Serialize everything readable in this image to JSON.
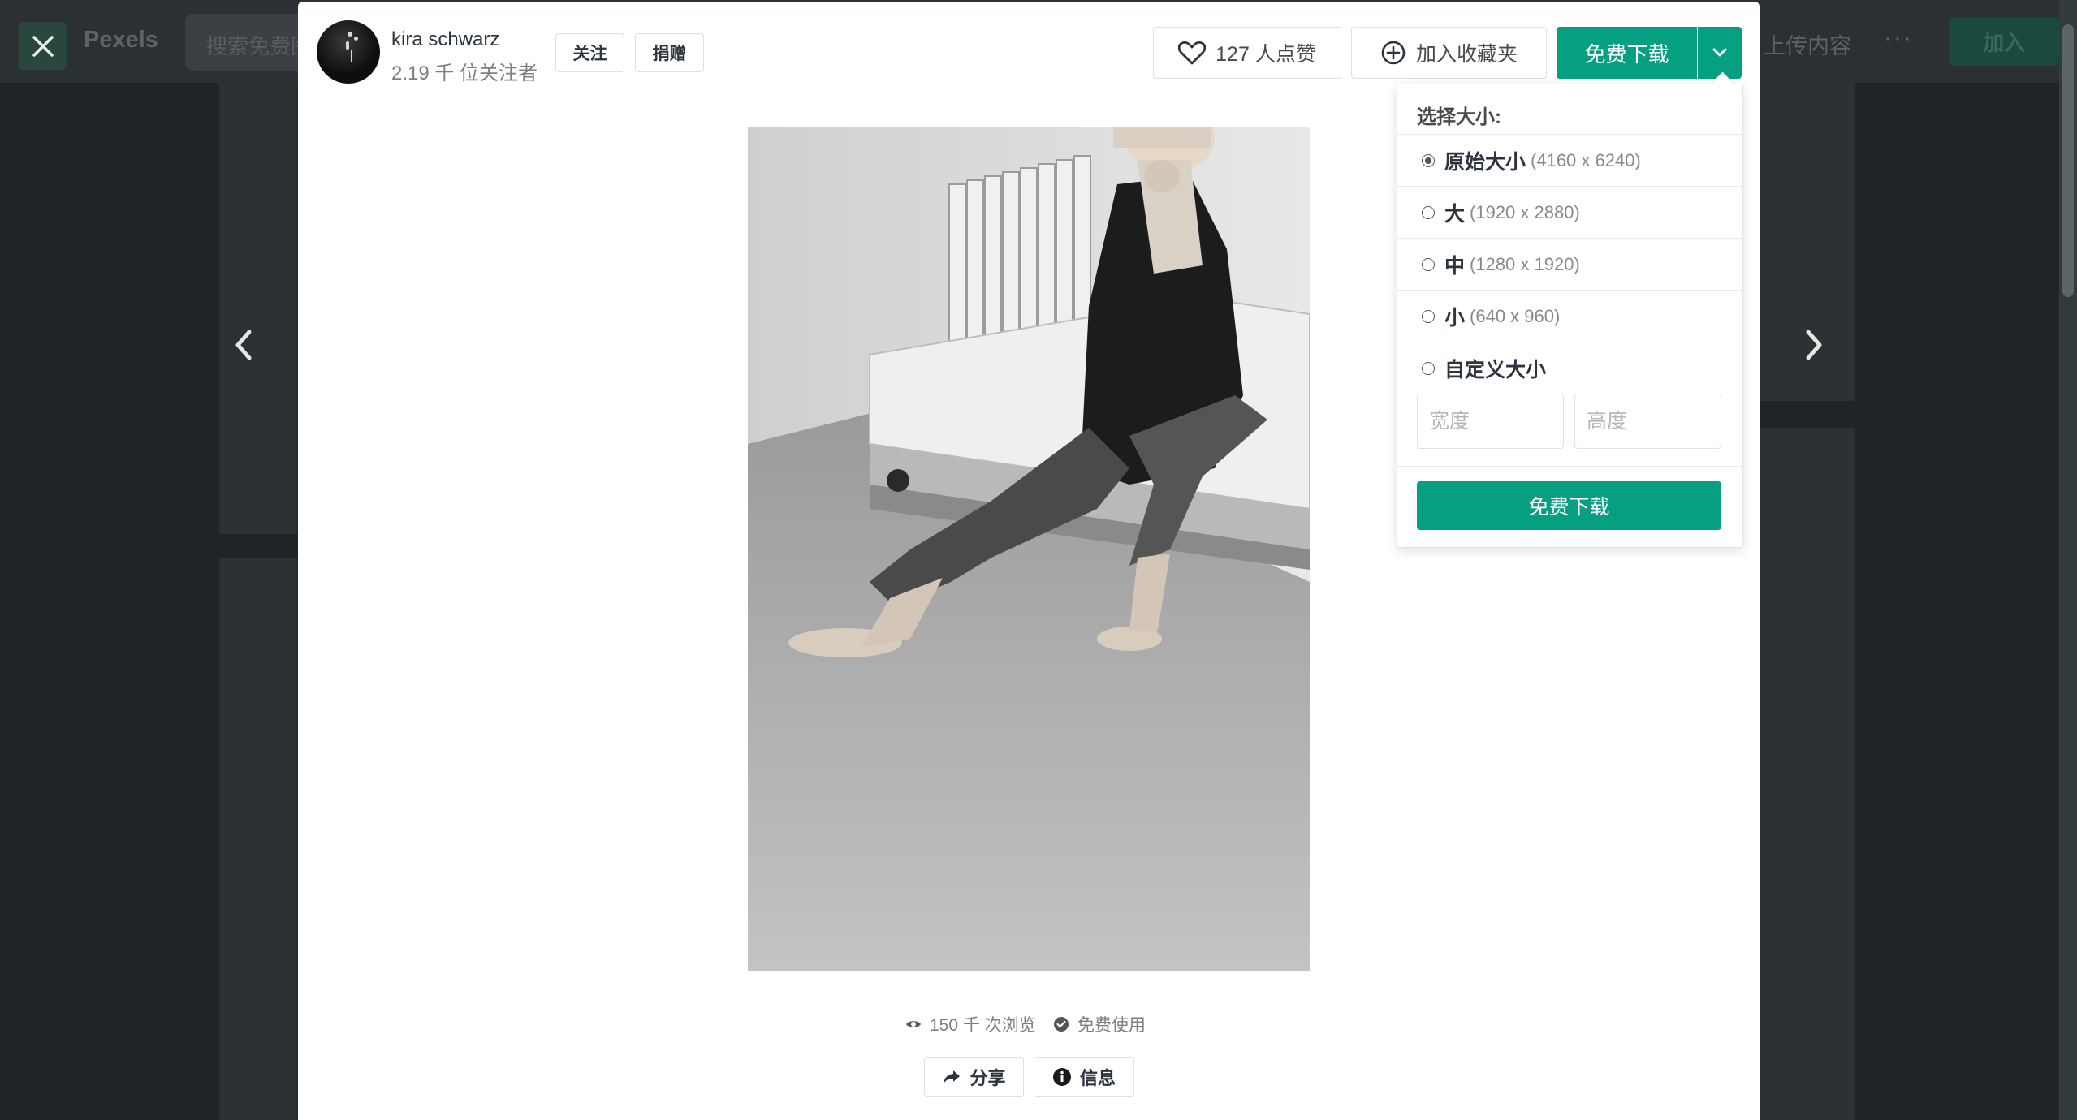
{
  "background": {
    "logo": "Pexels",
    "search_placeholder": "搜索免费图",
    "upload_label": "上传内容",
    "more_label": "···",
    "join_label": "加入"
  },
  "author": {
    "name": "kira schwarz",
    "followers": "2.19 千 位关注者",
    "follow_label": "关注",
    "donate_label": "捐赠"
  },
  "actions": {
    "like_label": "127 人点赞",
    "collect_label": "加入收藏夹",
    "download_label": "免费下载"
  },
  "dropdown": {
    "title": "选择大小:",
    "options": [
      {
        "name": "原始大小",
        "dims": "(4160 x 6240)",
        "selected": true
      },
      {
        "name": "大",
        "dims": "(1920 x 2880)",
        "selected": false
      },
      {
        "name": "中",
        "dims": "(1280 x 1920)",
        "selected": false
      },
      {
        "name": "小",
        "dims": "(640 x 960)",
        "selected": false
      },
      {
        "name": "自定义大小",
        "dims": "",
        "selected": false
      }
    ],
    "width_placeholder": "宽度",
    "height_placeholder": "高度",
    "button_label": "免费下载"
  },
  "stats": {
    "views": "150 千 次浏览",
    "license": "免费使用"
  },
  "footer": {
    "share_label": "分享",
    "info_label": "信息"
  },
  "colors": {
    "accent": "#05a081",
    "overlay": "#1f2427"
  }
}
